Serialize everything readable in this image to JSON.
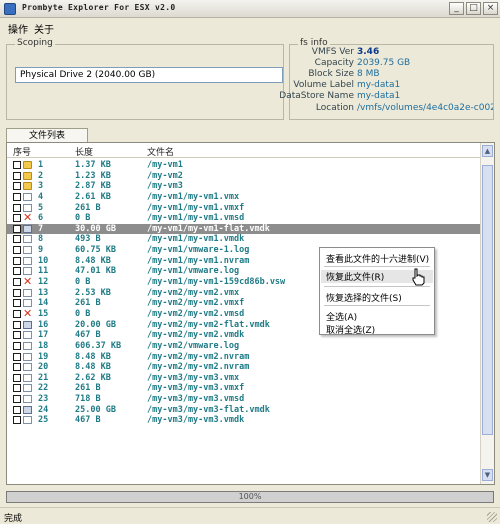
{
  "window": {
    "title": "Prombyte Explorer For ESX v2.0",
    "controls": {
      "minimize": "_",
      "maximize": "□",
      "close": "×"
    }
  },
  "menu": [
    "操作",
    "关于"
  ],
  "scoping": {
    "title": "Scoping",
    "drive_value": "Physical Drive 2 (2040.00 GB)"
  },
  "fs_info": {
    "title": "fs info",
    "fields": [
      {
        "label": "VMFS Ver",
        "value": "3.46"
      },
      {
        "label": "Capacity",
        "value": "2039.75 GB"
      },
      {
        "label": "Block Size",
        "value": "8 MB"
      },
      {
        "label": "Volume Label",
        "value": "my-data1"
      },
      {
        "label": "DataStore Name",
        "value": "my-data1"
      },
      {
        "label": "Location",
        "value": "/vmfs/volumes/4e4c0a2e-c00207af-c"
      }
    ]
  },
  "tab": {
    "label": "文件列表"
  },
  "list": {
    "headers": {
      "id": "序号",
      "size": "长度",
      "name": "文件名"
    },
    "rows": [
      {
        "icon": "folder",
        "id": "1",
        "size": "1.37 KB",
        "name": "/my-vm1"
      },
      {
        "icon": "folder",
        "id": "2",
        "size": "1.23 KB",
        "name": "/my-vm2"
      },
      {
        "icon": "folder",
        "id": "3",
        "size": "2.87 KB",
        "name": "/my-vm3"
      },
      {
        "icon": "file",
        "id": "4",
        "size": "2.61 KB",
        "name": "/my-vm1/my-vm1.vmx"
      },
      {
        "icon": "file",
        "id": "5",
        "size": "261 B",
        "name": "/my-vm1/my-vm1.vmxf"
      },
      {
        "icon": "deleted",
        "id": "6",
        "size": "0 B",
        "name": "/my-vm1/my-vm1.vmsd"
      },
      {
        "icon": "disk",
        "id": "7",
        "size": "30.00 GB",
        "name": "/my-vm1/my-vm1-flat.vmdk",
        "selected": true
      },
      {
        "icon": "file",
        "id": "8",
        "size": "493 B",
        "name": "/my-vm1/my-vm1.vmdk"
      },
      {
        "icon": "file",
        "id": "9",
        "size": "60.75 KB",
        "name": "/my-vm1/vmware-1.log"
      },
      {
        "icon": "file",
        "id": "10",
        "size": "8.48 KB",
        "name": "/my-vm1/my-vm1.nvram"
      },
      {
        "icon": "file",
        "id": "11",
        "size": "47.01 KB",
        "name": "/my-vm1/vmware.log"
      },
      {
        "icon": "deleted",
        "id": "12",
        "size": "0 B",
        "name": "/my-vm1/my-vm1-159cd86b.vsw"
      },
      {
        "icon": "file",
        "id": "13",
        "size": "2.53 KB",
        "name": "/my-vm2/my-vm2.vmx"
      },
      {
        "icon": "file",
        "id": "14",
        "size": "261 B",
        "name": "/my-vm2/my-vm2.vmxf"
      },
      {
        "icon": "deleted",
        "id": "15",
        "size": "0 B",
        "name": "/my-vm2/my-vm2.vmsd"
      },
      {
        "icon": "disk",
        "id": "16",
        "size": "20.00 GB",
        "name": "/my-vm2/my-vm2-flat.vmdk"
      },
      {
        "icon": "file",
        "id": "17",
        "size": "467 B",
        "name": "/my-vm2/my-vm2.vmdk"
      },
      {
        "icon": "file",
        "id": "18",
        "size": "606.37 KB",
        "name": "/my-vm2/vmware.log"
      },
      {
        "icon": "file",
        "id": "19",
        "size": "8.48 KB",
        "name": "/my-vm2/my-vm2.nvram"
      },
      {
        "icon": "file",
        "id": "20",
        "size": "8.48 KB",
        "name": "/my-vm2/my-vm2.nvram"
      },
      {
        "icon": "file",
        "id": "21",
        "size": "2.62 KB",
        "name": "/my-vm3/my-vm3.vmx"
      },
      {
        "icon": "file",
        "id": "22",
        "size": "261 B",
        "name": "/my-vm3/my-vm3.vmxf"
      },
      {
        "icon": "file",
        "id": "23",
        "size": "718 B",
        "name": "/my-vm3/my-vm3.vmsd"
      },
      {
        "icon": "disk",
        "id": "24",
        "size": "25.00 GB",
        "name": "/my-vm3/my-vm3-flat.vmdk"
      },
      {
        "icon": "file",
        "id": "25",
        "size": "467 B",
        "name": "/my-vm3/my-vm3.vmdk"
      }
    ]
  },
  "context_menu": {
    "items": [
      {
        "label": "查看此文件的十六进制(V)"
      },
      {
        "label": "恢复此文件(R)",
        "hover": true
      },
      {
        "label": "恢复选择的文件(S)"
      },
      {
        "label": "全选(A)"
      },
      {
        "label": "取消全选(Z)"
      }
    ]
  },
  "progress": {
    "value_text": "100%",
    "fraction": 1.0
  },
  "status": {
    "text": "完成"
  },
  "colors": {
    "selected_row": "#8d8d8d",
    "row_text": "#1f7b86",
    "deleted_icon": "#d9341e"
  }
}
